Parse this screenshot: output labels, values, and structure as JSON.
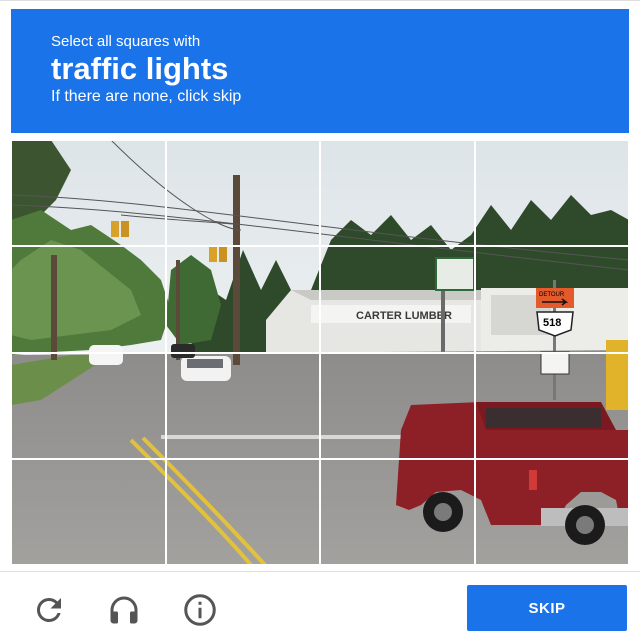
{
  "prompt": {
    "line1": "Select all squares with",
    "keyword": "traffic lights",
    "line3": "If there are none, click skip"
  },
  "grid": {
    "rows": 4,
    "cols": 4,
    "scene_text": {
      "store_sign": "CARTER LUMBER",
      "route_number": "518",
      "route_shield_top": "DETOUR"
    }
  },
  "footer": {
    "reload_icon": "reload-icon",
    "audio_icon": "headphones-icon",
    "info_icon": "info-icon",
    "skip_label": "SKIP"
  },
  "colors": {
    "brand_blue": "#1a73e8",
    "grid_line": "#ffffff"
  }
}
